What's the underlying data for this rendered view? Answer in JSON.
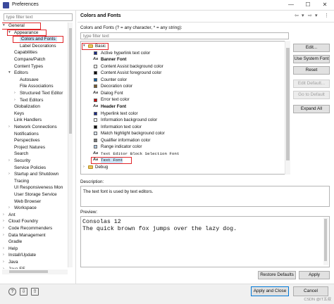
{
  "window": {
    "title": "Preferences",
    "minimize": "—",
    "maximize": "☐",
    "close": "✕"
  },
  "left_filter": {
    "placeholder": "type filter text"
  },
  "tree": [
    {
      "label": "General",
      "level": 0,
      "toggle": "▾",
      "selected": false,
      "boxed": true
    },
    {
      "label": "Appearance",
      "level": 1,
      "toggle": "▾",
      "selected": false,
      "boxed": true
    },
    {
      "label": "Colors and Fonts",
      "level": 2,
      "toggle": "",
      "selected": true,
      "boxed": true
    },
    {
      "label": "Label Decorations",
      "level": 2,
      "toggle": "",
      "selected": false
    },
    {
      "label": "Capabilities",
      "level": 1,
      "toggle": "",
      "selected": false
    },
    {
      "label": "Compare/Patch",
      "level": 1,
      "toggle": "",
      "selected": false
    },
    {
      "label": "Content Types",
      "level": 1,
      "toggle": "",
      "selected": false
    },
    {
      "label": "Editors",
      "level": 1,
      "toggle": "▾",
      "selected": false
    },
    {
      "label": "Autosave",
      "level": 2,
      "toggle": "",
      "selected": false
    },
    {
      "label": "File Associations",
      "level": 2,
      "toggle": "",
      "selected": false
    },
    {
      "label": "Structured Text Editor",
      "level": 2,
      "toggle": "›",
      "selected": false
    },
    {
      "label": "Text Editors",
      "level": 2,
      "toggle": "›",
      "selected": false
    },
    {
      "label": "Globalization",
      "level": 1,
      "toggle": "",
      "selected": false
    },
    {
      "label": "Keys",
      "level": 1,
      "toggle": "",
      "selected": false
    },
    {
      "label": "Link Handlers",
      "level": 1,
      "toggle": "",
      "selected": false
    },
    {
      "label": "Network Connections",
      "level": 1,
      "toggle": "›",
      "selected": false
    },
    {
      "label": "Notifications",
      "level": 1,
      "toggle": "",
      "selected": false
    },
    {
      "label": "Perspectives",
      "level": 1,
      "toggle": "",
      "selected": false
    },
    {
      "label": "Project Natures",
      "level": 1,
      "toggle": "",
      "selected": false
    },
    {
      "label": "Search",
      "level": 1,
      "toggle": "",
      "selected": false
    },
    {
      "label": "Security",
      "level": 1,
      "toggle": "›",
      "selected": false
    },
    {
      "label": "Service Policies",
      "level": 1,
      "toggle": "",
      "selected": false
    },
    {
      "label": "Startup and Shutdown",
      "level": 1,
      "toggle": "›",
      "selected": false
    },
    {
      "label": "Tracing",
      "level": 1,
      "toggle": "",
      "selected": false
    },
    {
      "label": "UI Responsiveness Mon",
      "level": 1,
      "toggle": "",
      "selected": false
    },
    {
      "label": "User Storage Service",
      "level": 1,
      "toggle": "",
      "selected": false
    },
    {
      "label": "Web Browser",
      "level": 1,
      "toggle": "",
      "selected": false
    },
    {
      "label": "Workspace",
      "level": 1,
      "toggle": "›",
      "selected": false
    },
    {
      "label": "Ant",
      "level": 0,
      "toggle": "›",
      "selected": false
    },
    {
      "label": "Cloud Foundry",
      "level": 0,
      "toggle": "›",
      "selected": false
    },
    {
      "label": "Code Recommenders",
      "level": 0,
      "toggle": "›",
      "selected": false
    },
    {
      "label": "Data Management",
      "level": 0,
      "toggle": "›",
      "selected": false
    },
    {
      "label": "Gradle",
      "level": 0,
      "toggle": "",
      "selected": false
    },
    {
      "label": "Help",
      "level": 0,
      "toggle": "›",
      "selected": false
    },
    {
      "label": "Install/Update",
      "level": 0,
      "toggle": "›",
      "selected": false
    },
    {
      "label": "Java",
      "level": 0,
      "toggle": "›",
      "selected": false
    },
    {
      "label": "Java EE",
      "level": 0,
      "toggle": "›",
      "selected": false
    }
  ],
  "page": {
    "title": "Colors and Fonts",
    "description": "Colors and Fonts (? = any character, * = any string):",
    "filter_placeholder": "type filter text",
    "nav_icons": [
      "⇦",
      "▾",
      "⇨",
      "▾",
      "⋮"
    ]
  },
  "cf_tree": [
    {
      "label": "Basic",
      "level": 0,
      "kind": "folder",
      "toggle": "▾",
      "boxed": true
    },
    {
      "label": "Active hyperlink text color",
      "level": 1,
      "kind": "color",
      "color": "#1a2a8a"
    },
    {
      "label": "Banner Font",
      "level": 1,
      "kind": "font",
      "bold": true
    },
    {
      "label": "Content Assist background color",
      "level": 1,
      "kind": "color",
      "color": "#ffffff"
    },
    {
      "label": "Content Assist foreground color",
      "level": 1,
      "kind": "color",
      "color": "#000000"
    },
    {
      "label": "Counter color",
      "level": 1,
      "kind": "color",
      "color": "#0b5fa5"
    },
    {
      "label": "Decoration color",
      "level": 1,
      "kind": "color",
      "color": "#7a5b2a"
    },
    {
      "label": "Dialog Font",
      "level": 1,
      "kind": "font"
    },
    {
      "label": "Error text color",
      "level": 1,
      "kind": "color",
      "color": "#d00000"
    },
    {
      "label": "Header Font",
      "level": 1,
      "kind": "font",
      "bold": true
    },
    {
      "label": "Hyperlink text color",
      "level": 1,
      "kind": "color",
      "color": "#1a2a8a"
    },
    {
      "label": "Information background color",
      "level": 1,
      "kind": "color",
      "color": "#ffffff"
    },
    {
      "label": "Information text color",
      "level": 1,
      "kind": "color",
      "color": "#000000"
    },
    {
      "label": "Match highlight background color",
      "level": 1,
      "kind": "color",
      "color": "#d8e4f6"
    },
    {
      "label": "Qualifier information color",
      "level": 1,
      "kind": "color",
      "color": "#7a7a7a"
    },
    {
      "label": "Range indicator color",
      "level": 1,
      "kind": "color",
      "color": "#b0c8e0"
    },
    {
      "label": "Text Editor Block Selection Font",
      "level": 1,
      "kind": "font",
      "mono": true
    },
    {
      "label": "Text Font",
      "level": 1,
      "kind": "font",
      "mono": true,
      "boxed": true
    },
    {
      "label": "Debug",
      "level": 0,
      "kind": "folder",
      "toggle": "›"
    }
  ],
  "buttons": {
    "edit": "Edit...",
    "use_system_font": "Use System Font",
    "reset": "Reset",
    "edit_default": "Edit Default...",
    "go_to_default": "Go to Default",
    "expand_all": "Expand All",
    "restore_defaults": "Restore Defaults",
    "apply": "Apply",
    "apply_close": "Apply and Close",
    "cancel": "Cancel"
  },
  "description": {
    "label": "Description:",
    "text": "The text font is used by text editors."
  },
  "preview": {
    "label": "Preview:",
    "line1": "Consolas 12",
    "line2": "The quick brown fox jumps over the lazy dog."
  },
  "footer": {
    "help_icon": "?",
    "import_icon": "⇩",
    "export_icon": "⇧"
  },
  "watermark": "CSDN @IT五叔"
}
